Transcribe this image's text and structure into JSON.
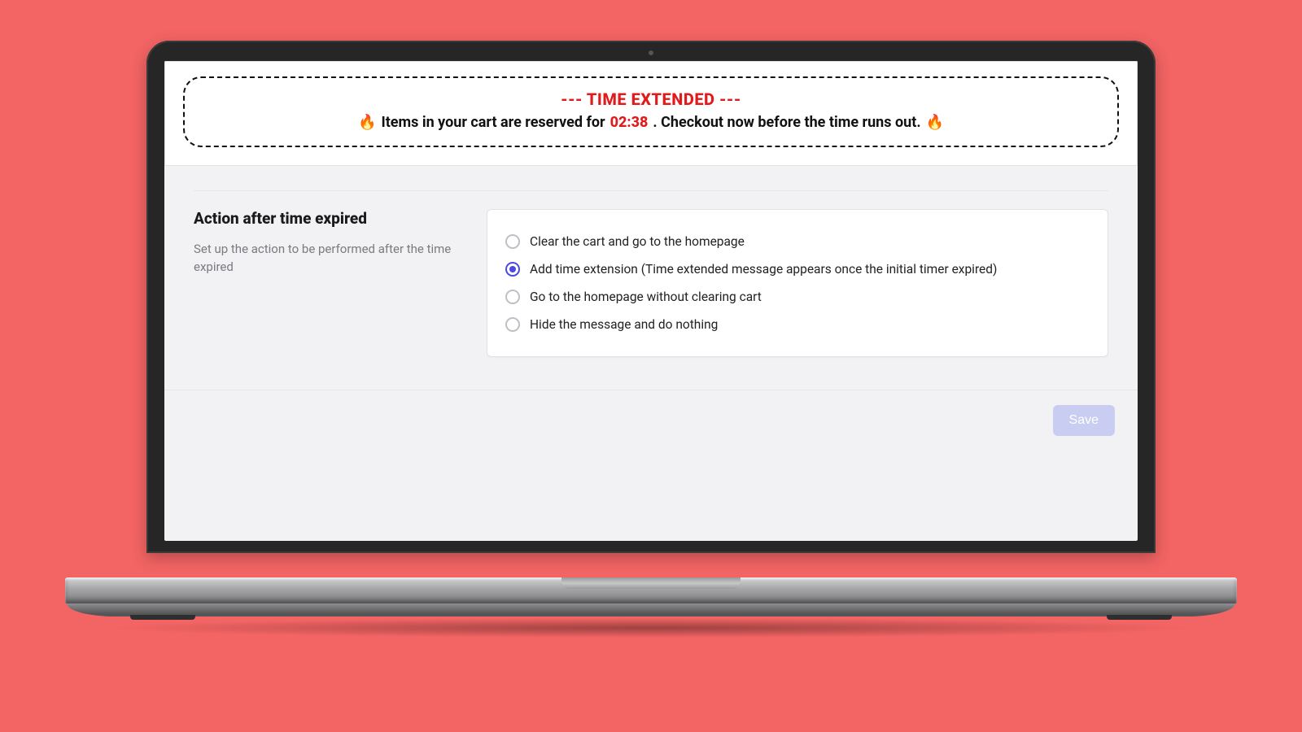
{
  "banner": {
    "title": "--- TIME EXTENDED ---",
    "prefix": "Items in your cart are reserved for",
    "time": "02:38",
    "suffix": ". Checkout now before the time runs out.",
    "fire_icon": "🔥"
  },
  "section": {
    "heading": "Action after time expired",
    "description": "Set up the action to be performed after the time expired"
  },
  "options": [
    {
      "label": "Clear the cart and go to the homepage",
      "checked": false
    },
    {
      "label": "Add time extension (Time extended message appears once the initial timer expired)",
      "checked": true
    },
    {
      "label": "Go to the homepage without clearing cart",
      "checked": false
    },
    {
      "label": "Hide the message and do nothing",
      "checked": false
    }
  ],
  "footer": {
    "save_label": "Save"
  }
}
